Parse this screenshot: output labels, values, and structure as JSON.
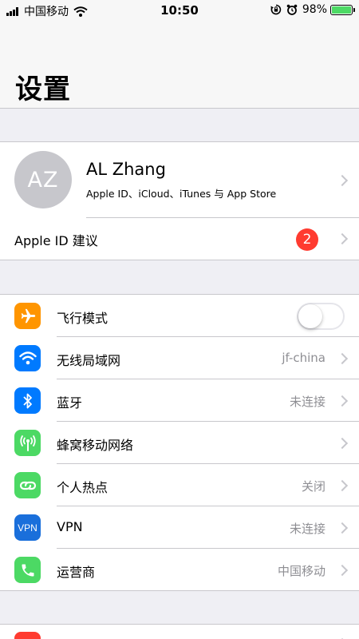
{
  "status_bar": {
    "carrier": "中国移动",
    "time": "10:50",
    "battery_percent": "98%",
    "battery_level": 0.98,
    "icons": [
      "signal-icon",
      "wifi-icon",
      "rotation-lock-icon",
      "alarm-icon",
      "battery-icon"
    ]
  },
  "header": {
    "title": "设置"
  },
  "profile": {
    "initials": "AZ",
    "name": "AL Zhang",
    "subtitle": "Apple ID、iCloud、iTunes 与 App Store",
    "suggestion_label": "Apple ID 建议",
    "suggestion_badge": "2"
  },
  "settings": [
    {
      "key": "airplane",
      "label": "飞行模式",
      "value": "",
      "icon": "airplane-icon",
      "color": "#ff9500",
      "toggle": false
    },
    {
      "key": "wifi",
      "label": "无线局域网",
      "value": "jf-china",
      "icon": "wifi-icon",
      "color": "#007aff"
    },
    {
      "key": "bluetooth",
      "label": "蓝牙",
      "value": "未连接",
      "icon": "bluetooth-icon",
      "color": "#007aff"
    },
    {
      "key": "cellular",
      "label": "蜂窝移动网络",
      "value": "",
      "icon": "antenna-icon",
      "color": "#4cd964"
    },
    {
      "key": "hotspot",
      "label": "个人热点",
      "value": "关闭",
      "icon": "hotspot-link-icon",
      "color": "#4cd964"
    },
    {
      "key": "vpn",
      "label": "VPN",
      "value": "未连接",
      "icon": "vpn-icon",
      "icon_text": "VPN",
      "color": "#1a6fdb"
    },
    {
      "key": "carrier",
      "label": "运营商",
      "value": "中国移动",
      "icon": "phone-icon",
      "color": "#4cd964"
    }
  ],
  "next_group": {
    "icon": "notifications-icon",
    "color": "#ff3b30"
  }
}
